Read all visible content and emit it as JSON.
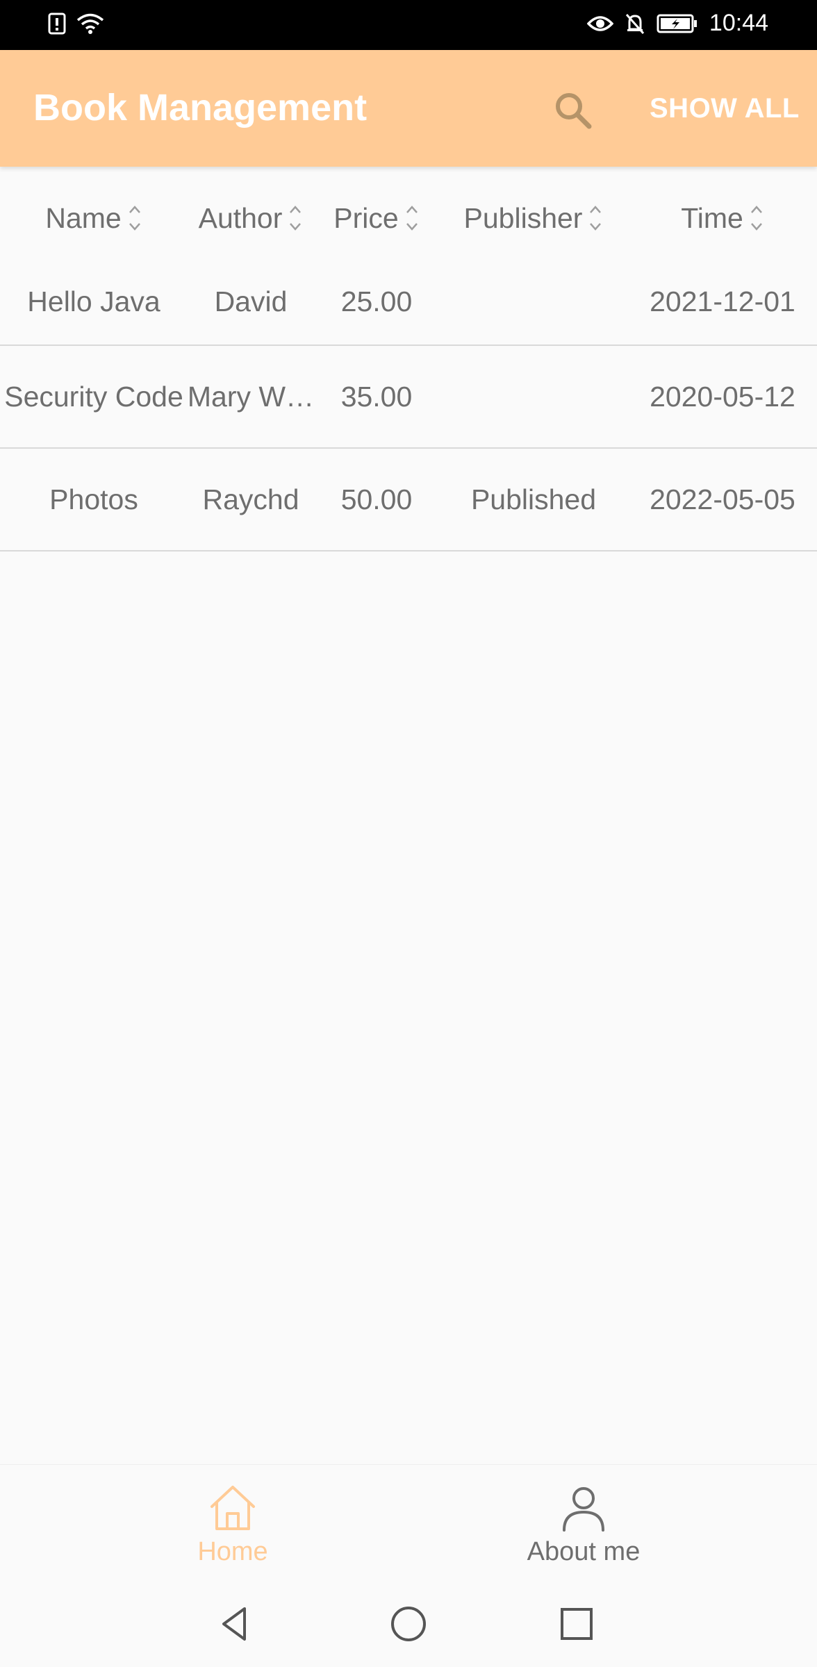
{
  "status_bar": {
    "time": "10:44",
    "icons": [
      "sim-alert-icon",
      "wifi-icon",
      "eye-icon",
      "bell-off-icon",
      "battery-charging-icon"
    ]
  },
  "app_bar": {
    "title": "Book Management",
    "search_icon": "search-icon",
    "show_all_label": "SHOW ALL",
    "background_color": "#ffcb96"
  },
  "table": {
    "columns": [
      "Name",
      "Author",
      "Price",
      "Publisher",
      "Time"
    ],
    "rows": [
      {
        "name": "Hello Java",
        "author": "David",
        "price": "25.00",
        "publisher": "",
        "time": "2021-12-01"
      },
      {
        "name": "Security Code",
        "author": "Mary W…",
        "price": "35.00",
        "publisher": "",
        "time": "2020-05-12"
      },
      {
        "name": "Photos",
        "author": "Raychd",
        "price": "50.00",
        "publisher": "Published",
        "time": "2022-05-05"
      }
    ]
  },
  "bottom_nav": {
    "items": [
      {
        "label": "Home",
        "icon": "home-icon",
        "active": true
      },
      {
        "label": "About me",
        "icon": "person-icon",
        "active": false
      }
    ],
    "active_color": "#ffcb96",
    "inactive_color": "#6e6e6e"
  },
  "system_nav": {
    "icons": [
      "back-icon",
      "home-circle-icon",
      "recents-icon"
    ]
  }
}
